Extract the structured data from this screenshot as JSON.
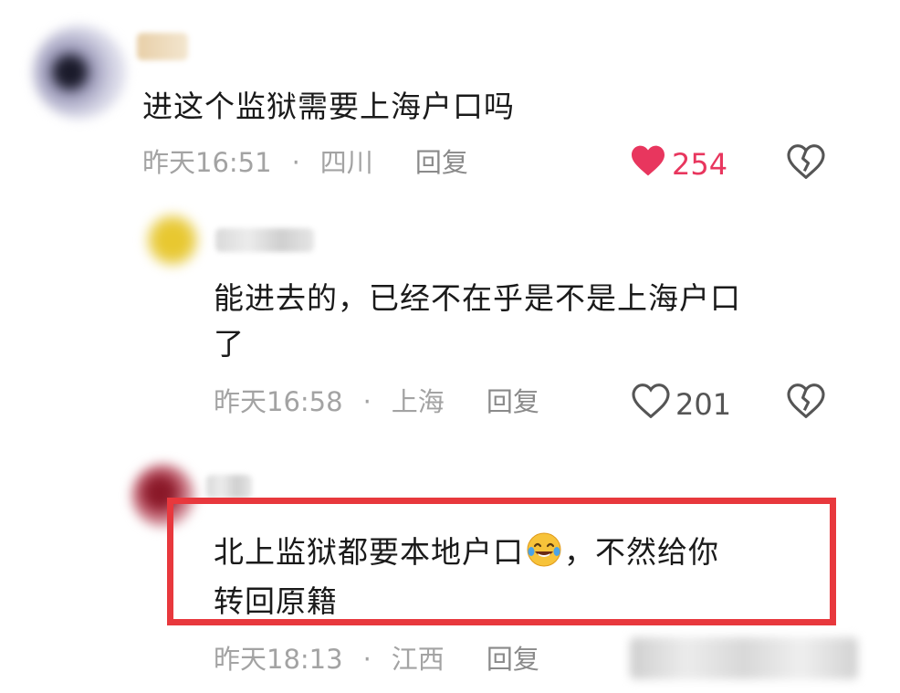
{
  "comments": [
    {
      "text": "进这个监狱需要上海户口吗",
      "time": "昨天16:51",
      "location": "四川",
      "reply_label": "回复",
      "likes": "254",
      "liked": true
    },
    {
      "text_line1": "能进去的，已经不在乎是不是上海户口",
      "text_line2": "了",
      "time": "昨天16:58",
      "location": "上海",
      "reply_label": "回复",
      "likes": "201",
      "liked": false
    },
    {
      "text_line1_a": "北上监狱都要本地户口",
      "text_line1_b": "，不然给你",
      "text_line2": "转回原籍",
      "time": "昨天18:13",
      "location": "江西",
      "reply_label": "回复"
    }
  ],
  "separator": "·",
  "colors": {
    "like_active": "#e8365e",
    "highlight_border": "#e8383d",
    "meta_text": "#a3a3a3"
  },
  "icons": [
    "heart-filled-icon",
    "heart-outline-icon",
    "broken-heart-icon",
    "laughing-tears-emoji-icon"
  ]
}
